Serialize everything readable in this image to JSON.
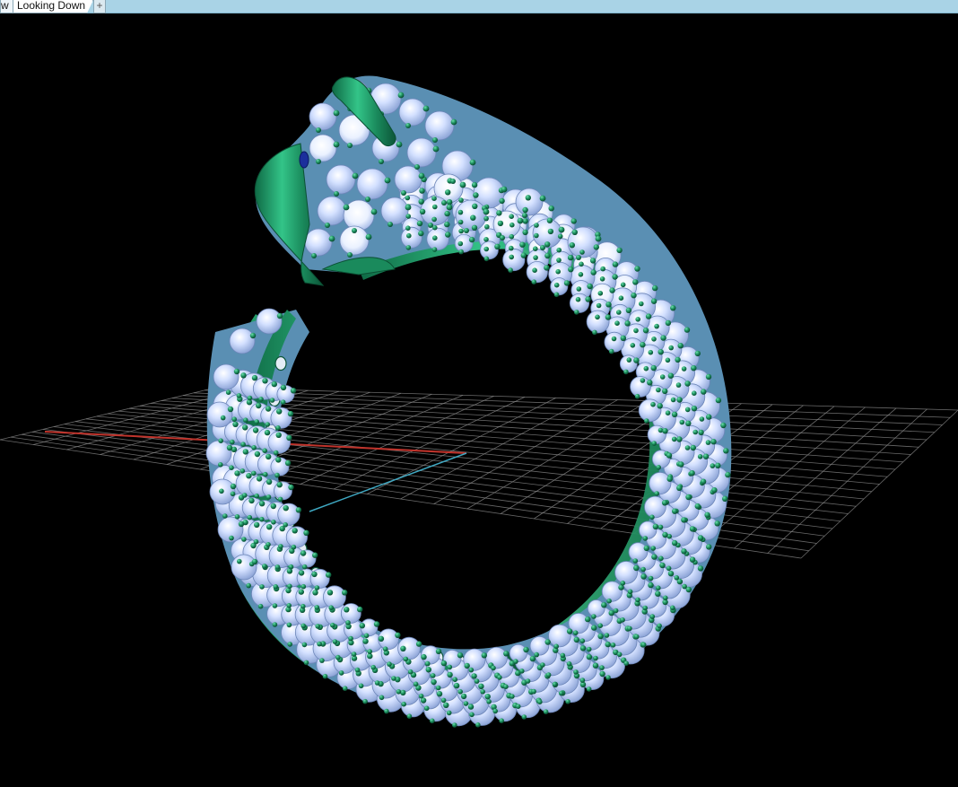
{
  "tabs": [
    {
      "label": "w"
    },
    {
      "label": "Looking Down"
    }
  ],
  "add_tab_icon": "plus-icon",
  "colors": {
    "background": "#000000",
    "tabbar": "#a9d3e6",
    "metal": "#1a8a5c",
    "metal_light": "#3fc98f",
    "gem": "#c4d6ff",
    "gem_highlight": "#ffffff",
    "grid": "#8c8c8c",
    "axis_x": "#c0342c",
    "axis_y": "#3fa8c2",
    "eye": "#1b2f9c"
  }
}
